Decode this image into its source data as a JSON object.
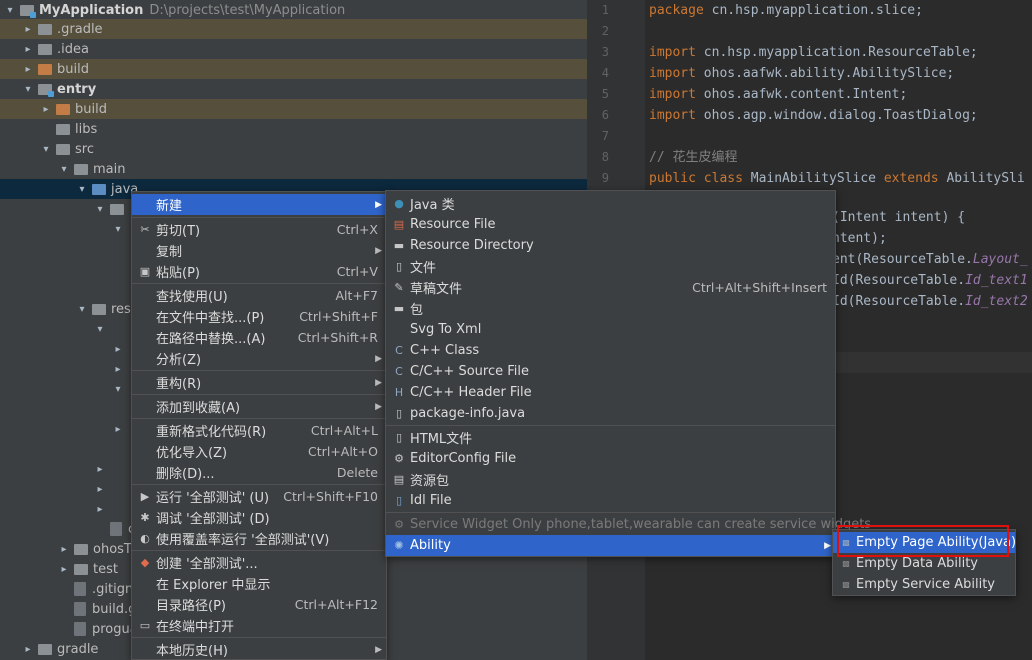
{
  "tree": {
    "rows": [
      {
        "label": "MyApplication",
        "path": "D:\\projects\\test\\MyApplication"
      },
      {
        "label": ".gradle"
      },
      {
        "label": ".idea"
      },
      {
        "label": "build"
      },
      {
        "label": "entry"
      },
      {
        "label": "build"
      },
      {
        "label": "libs"
      },
      {
        "label": "src"
      },
      {
        "label": "main"
      },
      {
        "label": "java"
      },
      {
        "label": "res"
      },
      {
        "label": "con"
      },
      {
        "label": "ohosT"
      },
      {
        "label": "test"
      },
      {
        "label": ".gitignore"
      },
      {
        "label": "build.grad"
      },
      {
        "label": "proguard"
      },
      {
        "label": "gradle"
      }
    ]
  },
  "editor": {
    "line_numbers": [
      "1",
      "2",
      "3",
      "4",
      "5",
      "6",
      "7",
      "8",
      "9"
    ],
    "line1_kw": "package ",
    "line1_rest": "cn.hsp.myapplication.slice;",
    "import_kw": "import ",
    "import1": "cn.hsp.myapplication.ResourceTable;",
    "import2": "ohos.aafwk.ability.AbilitySlice;",
    "import3": "ohos.aafwk.content.Intent;",
    "import4": "ohos.agp.window.dialog.ToastDialog;",
    "comment": "// 花生皮编程",
    "class_kw1": "public class ",
    "class_name": "MainAbilitySlice ",
    "class_kw2": "extends ",
    "class_rest": "AbilitySli",
    "frag1": "(Intent intent) {",
    "frag2": "ntent);",
    "frag3_a": "ent(ResourceTable.",
    "frag3_b": "Layout_",
    "frag4_a": "Id(ResourceTable.",
    "frag4_b": "Id_text1",
    "frag5_a": "Id(ResourceTable.",
    "frag5_b": "Id_text2"
  },
  "context_menu": {
    "new": "新建",
    "cut": "剪切(T)",
    "cut_sc": "Ctrl+X",
    "copy": "复制",
    "paste": "粘贴(P)",
    "paste_sc": "Ctrl+V",
    "find_usages": "查找使用(U)",
    "find_usages_sc": "Alt+F7",
    "find_in_files": "在文件中查找...(P)",
    "find_in_files_sc": "Ctrl+Shift+F",
    "replace_in_path": "在路径中替换...(A)",
    "replace_in_path_sc": "Ctrl+Shift+R",
    "analyze": "分析(Z)",
    "refactor": "重构(R)",
    "add_favorites": "添加到收藏(A)",
    "reformat": "重新格式化代码(R)",
    "reformat_sc": "Ctrl+Alt+L",
    "optimize_imports": "优化导入(Z)",
    "optimize_imports_sc": "Ctrl+Alt+O",
    "delete": "删除(D)...",
    "delete_sc": "Delete",
    "run_all": "运行 '全部测试' (U)",
    "run_all_sc": "Ctrl+Shift+F10",
    "debug_all": "调试 '全部测试' (D)",
    "coverage": "使用覆盖率运行 '全部测试'(V)",
    "create_all": "创建 '全部测试'...",
    "show_explorer": "在 Explorer 中显示",
    "dir_path": "目录路径(P)",
    "dir_path_sc": "Ctrl+Alt+F12",
    "open_terminal": "在终端中打开",
    "local_history": "本地历史(H)"
  },
  "new_menu": {
    "java_class": "Java 类",
    "resource_file": "Resource File",
    "resource_dir": "Resource Directory",
    "file": "文件",
    "scratch": "草稿文件",
    "scratch_sc": "Ctrl+Alt+Shift+Insert",
    "package": "包",
    "svg_xml": "Svg To Xml",
    "cpp_class": "C++ Class",
    "cpp_source": "C/C++ Source File",
    "cpp_header": "C/C++ Header File",
    "package_info": "package-info.java",
    "html_file": "HTML文件",
    "editorconfig": "EditorConfig File",
    "resource_bundle": "资源包",
    "idl_file": "Idl File",
    "service_widget": "Service Widget Only phone,tablet,wearable can create service widgets",
    "ability": "Ability"
  },
  "ability_menu": {
    "empty_page": "Empty Page Ability(Java)",
    "empty_data": "Empty Data Ability",
    "empty_service": "Empty Service Ability"
  },
  "colors": {
    "highlight": "#2f65ca",
    "keyword": "#cc7832",
    "excluded_folder_row": "#554f3b",
    "annotation_box": "#e01010"
  }
}
